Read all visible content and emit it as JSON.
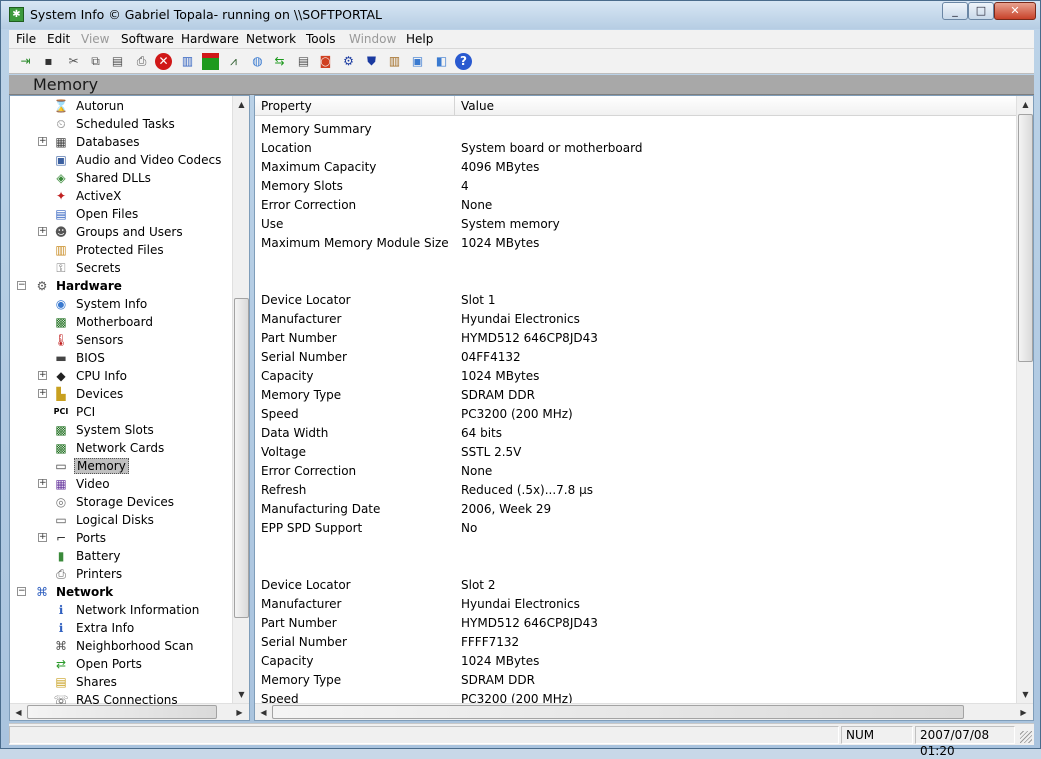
{
  "window": {
    "title": "System Info  © Gabriel Topala- running on \\\\SOFTPORTAL",
    "min": "_",
    "max": "□",
    "close": "✕"
  },
  "menu": [
    "File",
    "Edit",
    "View",
    "Software",
    "Hardware",
    "Network",
    "Tools",
    "Window",
    "Help"
  ],
  "section_title": "Memory",
  "tree": [
    {
      "label": "Autorun",
      "icon": "hourglass-icon",
      "glyph": "⌛",
      "color": "#2a8a2a",
      "level": 2,
      "expand": ""
    },
    {
      "label": "Scheduled Tasks",
      "icon": "tasks-icon",
      "glyph": "⏲",
      "color": "#777",
      "level": 2,
      "expand": ""
    },
    {
      "label": "Databases",
      "icon": "database-icon",
      "glyph": "▦",
      "color": "#444",
      "level": 2,
      "expand": "+"
    },
    {
      "label": "Audio and Video Codecs",
      "icon": "codec-icon",
      "glyph": "▣",
      "color": "#3a5fa0",
      "level": 2,
      "expand": ""
    },
    {
      "label": "Shared DLLs",
      "icon": "dll-icon",
      "glyph": "◈",
      "color": "#3a8a3a",
      "level": 2,
      "expand": ""
    },
    {
      "label": "ActiveX",
      "icon": "activex-icon",
      "glyph": "✦",
      "color": "#c02020",
      "level": 2,
      "expand": ""
    },
    {
      "label": "Open Files",
      "icon": "file-icon",
      "glyph": "▤",
      "color": "#3060c0",
      "level": 2,
      "expand": ""
    },
    {
      "label": "Groups and Users",
      "icon": "users-icon",
      "glyph": "☻",
      "color": "#555",
      "level": 2,
      "expand": "+"
    },
    {
      "label": "Protected Files",
      "icon": "protected-file-icon",
      "glyph": "▥",
      "color": "#c88a20",
      "level": 2,
      "expand": ""
    },
    {
      "label": "Secrets",
      "icon": "key-icon",
      "glyph": "⚿",
      "color": "#777",
      "level": 2,
      "expand": ""
    },
    {
      "label": "Hardware",
      "icon": "hardware-icon",
      "glyph": "⚙",
      "color": "#555",
      "level": 1,
      "expand": "−",
      "bold": true
    },
    {
      "label": "System Info",
      "icon": "system-info-icon",
      "glyph": "◉",
      "color": "#3a7ad0",
      "level": 2,
      "expand": ""
    },
    {
      "label": "Motherboard",
      "icon": "motherboard-icon",
      "glyph": "▩",
      "color": "#1e6e1e",
      "level": 2,
      "expand": ""
    },
    {
      "label": "Sensors",
      "icon": "thermometer-icon",
      "glyph": "🌡",
      "color": "#c02020",
      "level": 2,
      "expand": ""
    },
    {
      "label": "BIOS",
      "icon": "chip-icon",
      "glyph": "▬",
      "color": "#444",
      "level": 2,
      "expand": ""
    },
    {
      "label": "CPU Info",
      "icon": "cpu-icon",
      "glyph": "◆",
      "color": "#222",
      "level": 2,
      "expand": "+"
    },
    {
      "label": "Devices",
      "icon": "devices-icon",
      "glyph": "▙",
      "color": "#c8a020",
      "level": 2,
      "expand": "+"
    },
    {
      "label": "PCI",
      "icon": "pci-icon",
      "glyph": "PCI",
      "color": "#000",
      "level": 2,
      "expand": ""
    },
    {
      "label": "System Slots",
      "icon": "slot-icon",
      "glyph": "▩",
      "color": "#1e6e1e",
      "level": 2,
      "expand": ""
    },
    {
      "label": "Network Cards",
      "icon": "network-card-icon",
      "glyph": "▩",
      "color": "#1e6e1e",
      "level": 2,
      "expand": ""
    },
    {
      "label": "Memory",
      "icon": "memory-icon",
      "glyph": "▭",
      "color": "#444",
      "level": 2,
      "expand": "",
      "selected": true
    },
    {
      "label": "Video",
      "icon": "video-icon",
      "glyph": "▦",
      "color": "#6a3aa0",
      "level": 2,
      "expand": "+"
    },
    {
      "label": "Storage Devices",
      "icon": "storage-icon",
      "glyph": "◎",
      "color": "#777",
      "level": 2,
      "expand": ""
    },
    {
      "label": "Logical Disks",
      "icon": "disk-icon",
      "glyph": "▭",
      "color": "#555",
      "level": 2,
      "expand": ""
    },
    {
      "label": "Ports",
      "icon": "port-icon",
      "glyph": "⌐",
      "color": "#333",
      "level": 2,
      "expand": "+"
    },
    {
      "label": "Battery",
      "icon": "battery-icon",
      "glyph": "▮",
      "color": "#3a8a3a",
      "level": 2,
      "expand": ""
    },
    {
      "label": "Printers",
      "icon": "printer-icon",
      "glyph": "⎙",
      "color": "#555",
      "level": 2,
      "expand": ""
    },
    {
      "label": "Network",
      "icon": "network-icon",
      "glyph": "⌘",
      "color": "#3060c0",
      "level": 1,
      "expand": "−",
      "bold": true
    },
    {
      "label": "Network Information",
      "icon": "info-icon",
      "glyph": "ℹ",
      "color": "#3060c0",
      "level": 2,
      "expand": ""
    },
    {
      "label": "Extra Info",
      "icon": "info-icon",
      "glyph": "ℹ",
      "color": "#3060c0",
      "level": 2,
      "expand": ""
    },
    {
      "label": "Neighborhood Scan",
      "icon": "scan-icon",
      "glyph": "⌘",
      "color": "#555",
      "level": 2,
      "expand": ""
    },
    {
      "label": "Open Ports",
      "icon": "open-ports-icon",
      "glyph": "⇄",
      "color": "#2a9a2a",
      "level": 2,
      "expand": ""
    },
    {
      "label": "Shares",
      "icon": "shares-icon",
      "glyph": "▤",
      "color": "#c8a020",
      "level": 2,
      "expand": ""
    },
    {
      "label": "RAS Connections",
      "icon": "ras-icon",
      "glyph": "☏",
      "color": "#555",
      "level": 2,
      "expand": ""
    }
  ],
  "columns": {
    "property": "Property",
    "value": "Value"
  },
  "rows": [
    {
      "p": "Memory Summary",
      "v": ""
    },
    {
      "p": "Location",
      "v": "System board or motherboard"
    },
    {
      "p": "Maximum Capacity",
      "v": "4096 MBytes"
    },
    {
      "p": "Memory Slots",
      "v": "4"
    },
    {
      "p": "Error Correction",
      "v": "None"
    },
    {
      "p": "Use",
      "v": "System memory"
    },
    {
      "p": "Maximum Memory Module Size",
      "v": "1024 MBytes"
    },
    {
      "p": "",
      "v": ""
    },
    {
      "p": "",
      "v": ""
    },
    {
      "p": "Device Locator",
      "v": "Slot 1"
    },
    {
      "p": "Manufacturer",
      "v": "Hyundai Electronics"
    },
    {
      "p": "Part Number",
      "v": "HYMD512 646CP8JD43"
    },
    {
      "p": "Serial Number",
      "v": "04FF4132"
    },
    {
      "p": "Capacity",
      "v": "1024 MBytes"
    },
    {
      "p": "Memory Type",
      "v": "SDRAM DDR"
    },
    {
      "p": "Speed",
      "v": "PC3200 (200 MHz)"
    },
    {
      "p": "Data Width",
      "v": "64 bits"
    },
    {
      "p": "Voltage",
      "v": "SSTL 2.5V"
    },
    {
      "p": "Error Correction",
      "v": "None"
    },
    {
      "p": "Refresh",
      "v": "Reduced (.5x)...7.8 µs"
    },
    {
      "p": "Manufacturing Date",
      "v": "2006, Week 29"
    },
    {
      "p": "EPP SPD Support",
      "v": "No"
    },
    {
      "p": "",
      "v": ""
    },
    {
      "p": "",
      "v": ""
    },
    {
      "p": "Device Locator",
      "v": "Slot 2"
    },
    {
      "p": "Manufacturer",
      "v": "Hyundai Electronics"
    },
    {
      "p": "Part Number",
      "v": "HYMD512 646CP8JD43"
    },
    {
      "p": "Serial Number",
      "v": "FFFF7132"
    },
    {
      "p": "Capacity",
      "v": "1024 MBytes"
    },
    {
      "p": "Memory Type",
      "v": "SDRAM DDR"
    },
    {
      "p": "Speed",
      "v": "PC3200 (200 MHz)"
    }
  ],
  "status": {
    "num": "NUM",
    "datetime": "2007/07/08 01:20"
  }
}
